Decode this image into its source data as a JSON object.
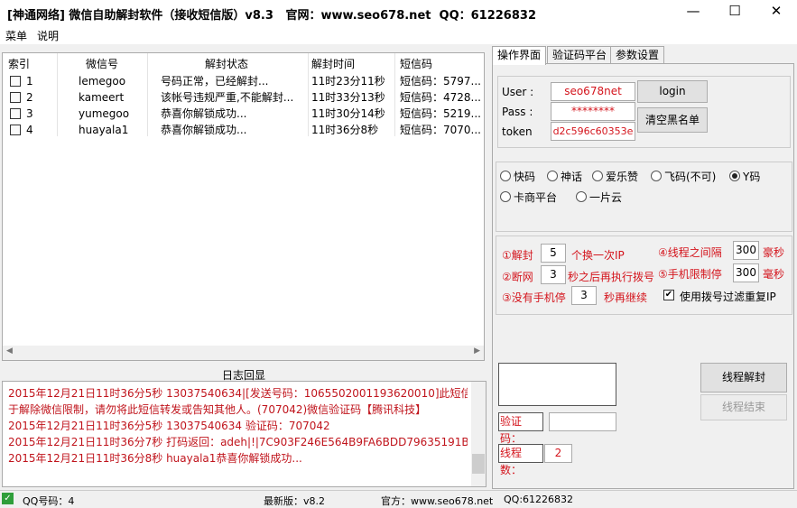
{
  "window": {
    "title": "[神通网络] 微信自助解封软件（接收短信版）v8.3   官网：www.seo678.net  QQ：61226832"
  },
  "menu": [
    "菜单",
    "说明"
  ],
  "table": {
    "headers": [
      "索引",
      "微信号",
      "解封状态",
      "解封时间",
      "短信码"
    ],
    "rows": [
      {
        "index": "1",
        "wechat": "lemegoo",
        "status": "号码正常，已经解封...",
        "time": "11时23分11秒",
        "sms": "短信码：5797..."
      },
      {
        "index": "2",
        "wechat": "kameert",
        "status": "该帐号违规严重,不能解封...",
        "time": "11时33分13秒",
        "sms": "短信码：4728..."
      },
      {
        "index": "3",
        "wechat": "yumegoo",
        "status": "恭喜你解锁成功...",
        "time": "11时30分14秒",
        "sms": "短信码：5219..."
      },
      {
        "index": "4",
        "wechat": "huayala1",
        "status": "恭喜你解锁成功...",
        "time": "11时36分8秒",
        "sms": "短信码：7070..."
      }
    ]
  },
  "log": {
    "label": "日志回显",
    "lines": [
      "2015年12月21日11时36分5秒  13037540634|[发送号码：1065502001193620010]此短信仅用",
      "于解除微信限制，请勿将此短信转发或告知其他人。(707042)微信验证码【腾讯科技】",
      "2015年12月21日11时36分5秒  13037540634 验证码：707042",
      "2015年12月21日11时36分7秒  打码返回：adeh|!|7C903F246E564B9FA6BDD79635191B00",
      "2015年12月21日11时36分8秒  huayala1恭喜你解锁成功..."
    ]
  },
  "tabs": [
    "操作界面",
    "验证码平台",
    "参数设置"
  ],
  "login": {
    "user_label": "User :",
    "user": "seo678net",
    "pass_label": "Pass :",
    "pass": "********",
    "token_label": "token",
    "token": "d2c596c60353e",
    "login_btn": "login",
    "clear_btn": "清空黑名单"
  },
  "platforms": {
    "options": [
      "快码",
      "神话",
      "爱乐赞",
      "飞码(不可)",
      "Y码",
      "卡商平台",
      "一片云"
    ],
    "selected": "Y码"
  },
  "settings": {
    "s1_pre": "①解封",
    "s1_val": "5",
    "s1_post": "个换一次IP",
    "s2_pre": "②断网",
    "s2_val": "3",
    "s2_post": "秒之后再执行拨号",
    "s3_pre": "③没有手机停",
    "s3_val": "3",
    "s3_post": "秒再继续",
    "s4_pre": "④线程之间隔",
    "s4_val": "300",
    "s4_post": "豪秒",
    "s5_pre": "⑤手机限制停",
    "s5_val": "300",
    "s5_post": "毫秒",
    "filter_label": "使用拨号过滤重复IP",
    "filter_checked": true
  },
  "captcha": {
    "label": "验证码：",
    "value": ""
  },
  "threads": {
    "label": "线程数：",
    "value": "2"
  },
  "buttons": {
    "start": "线程解封",
    "stop": "线程结束"
  },
  "status": {
    "qq": "QQ号码：4",
    "version": "最新版：v8.2",
    "site": "官方：www.seo678.net",
    "qq_contact": "QQ:61226832"
  }
}
